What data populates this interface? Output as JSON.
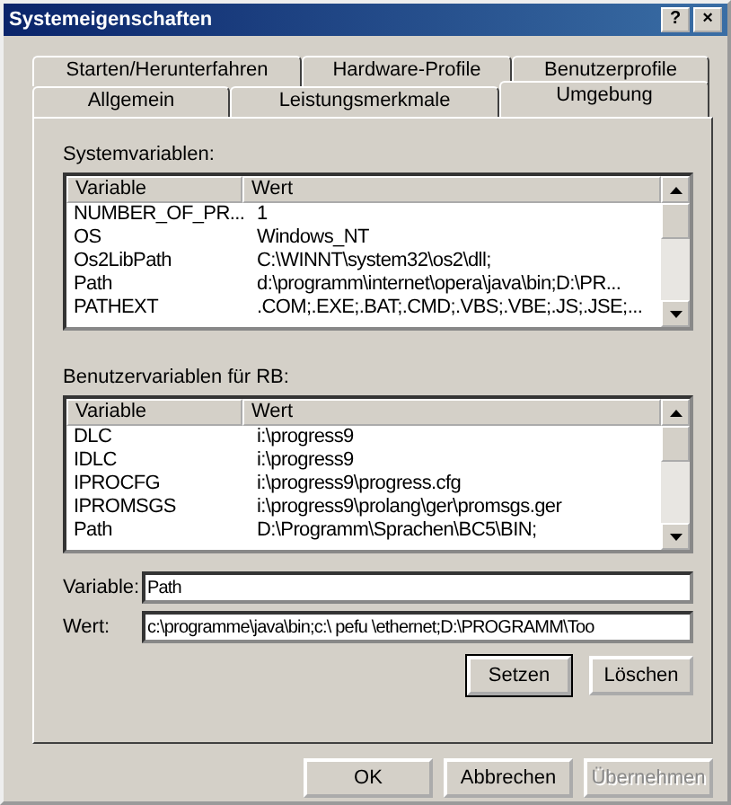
{
  "window": {
    "title": "Systemeigenschaften",
    "title_buttons": [
      "?",
      "×"
    ]
  },
  "tab_rows": [
    [
      {
        "label": "Starten/Herunterfahren",
        "selected": false
      },
      {
        "label": "Hardware-Profile",
        "selected": false
      },
      {
        "label": "Benutzerprofile",
        "selected": false
      }
    ],
    [
      {
        "label": "Allgemein",
        "selected": false
      },
      {
        "label": "Leistungsmerkmale",
        "selected": false
      },
      {
        "label": "Umgebung",
        "selected": true
      }
    ]
  ],
  "system_variables": {
    "label": "Systemvariablen:",
    "columns": [
      "Variable",
      "Wert"
    ],
    "rows": [
      {
        "variable": "NUMBER_OF_PR...",
        "value": "1"
      },
      {
        "variable": "OS",
        "value": "Windows_NT"
      },
      {
        "variable": "Os2LibPath",
        "value": "C:\\WINNT\\system32\\os2\\dll;"
      },
      {
        "variable": "Path",
        "value": "d:\\programm\\internet\\opera\\java\\bin;D:\\PR..."
      },
      {
        "variable": "PATHEXT",
        "value": ".COM;.EXE;.BAT;.CMD;.VBS;.VBE;.JS;.JSE;..."
      }
    ]
  },
  "user_variables": {
    "label": "Benutzervariablen für RB:",
    "columns": [
      "Variable",
      "Wert"
    ],
    "rows": [
      {
        "variable": "DLC",
        "value": "i:\\progress9"
      },
      {
        "variable": "IDLC",
        "value": "i:\\progress9"
      },
      {
        "variable": "IPROCFG",
        "value": "i:\\progress9\\progress.cfg"
      },
      {
        "variable": "IPROMSGS",
        "value": "i:\\progress9\\prolang\\ger\\promsgs.ger"
      },
      {
        "variable": "Path",
        "value": "D:\\Programm\\Sprachen\\BC5\\BIN;"
      }
    ]
  },
  "fields": [
    {
      "label": "Variable:",
      "value": "Path"
    },
    {
      "label": "Wert:",
      "value": "c:\\programme\\java\\bin;c:\\ pefu \\ethernet;D:\\PROGRAMM\\Too"
    }
  ],
  "panel_buttons": [
    {
      "label": "Setzen",
      "disabled": false
    },
    {
      "label": "Löschen",
      "disabled": false
    }
  ],
  "buttons": [
    {
      "label": "OK",
      "disabled": false
    },
    {
      "label": "Abbrechen",
      "disabled": false
    },
    {
      "label": "Übernehmen",
      "disabled": true
    }
  ]
}
